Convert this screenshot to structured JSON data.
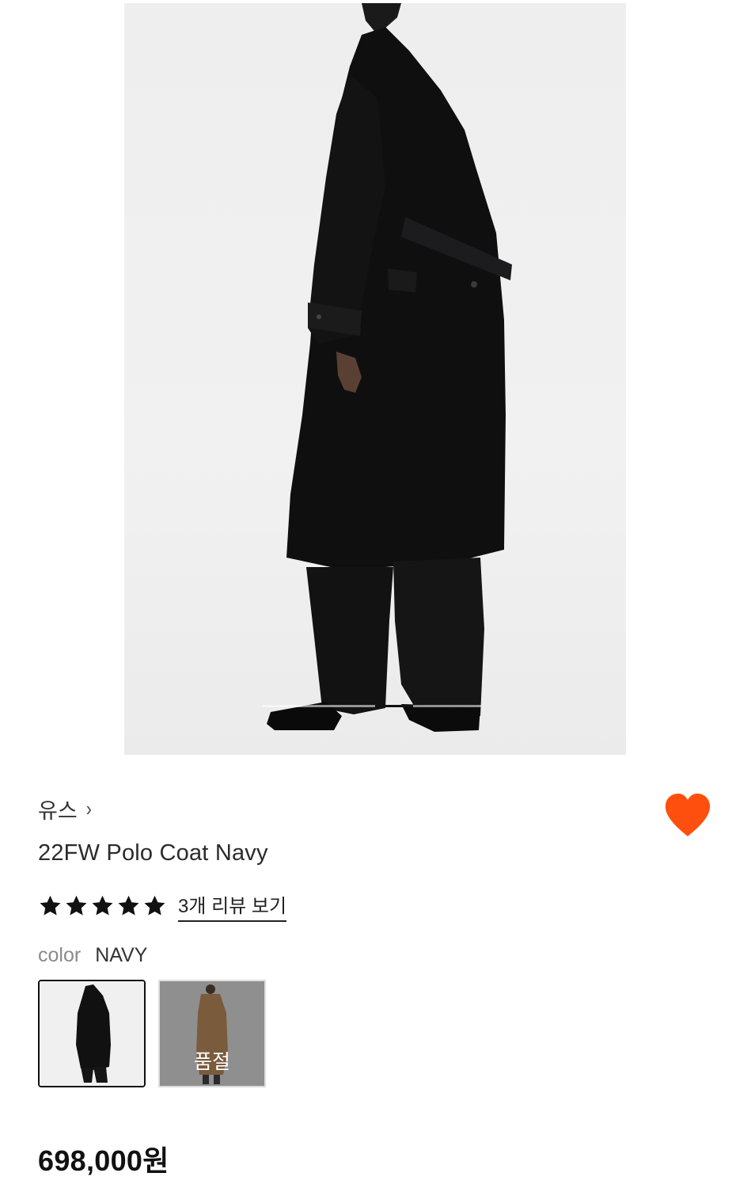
{
  "product": {
    "brand": "유스",
    "brand_chevron": "›",
    "title": "22FW Polo Coat Navy",
    "rating_stars": 5,
    "review_link": "3개 리뷰 보기",
    "color_label": "color",
    "color_value": "NAVY",
    "swatches": [
      {
        "name": "navy",
        "selected": true,
        "sold_out": false
      },
      {
        "name": "camel",
        "selected": false,
        "sold_out": true,
        "label": "품절"
      }
    ],
    "price": "698,000원",
    "liked": true
  },
  "colors": {
    "like": "#ff4f0f",
    "text": "#222222",
    "muted": "#8a8a8a"
  },
  "carousel": {
    "active_index": 2,
    "total": 5
  }
}
